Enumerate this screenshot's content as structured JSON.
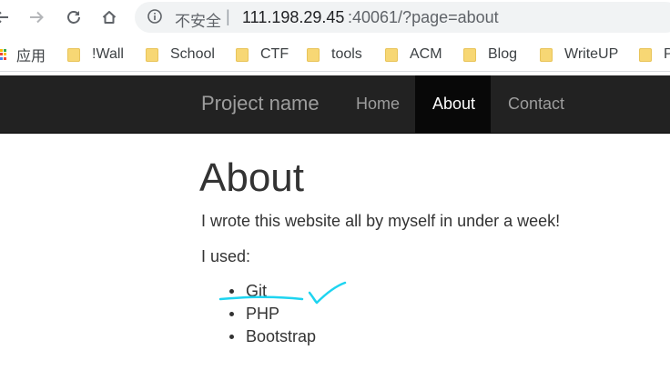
{
  "browser": {
    "security_label": "不安全",
    "separator": "|",
    "url_host": "111.198.29.45",
    "url_rest": ":40061/?page=about"
  },
  "bookmarks": {
    "apps_label": "应用",
    "items": [
      "!Wall",
      "School",
      "CTF",
      "tools",
      "ACM",
      "Blog",
      "WriteUP",
      "P"
    ],
    "folder_color": "#f7d774"
  },
  "navbar": {
    "brand": "Project name",
    "links": [
      "Home",
      "About",
      "Contact"
    ],
    "active": "About",
    "background": "#222222"
  },
  "page": {
    "title": "About",
    "intro": "I wrote this website all by myself in under a week!",
    "used_label": "I used:",
    "tools": [
      "Git",
      "PHP",
      "Bootstrap"
    ]
  },
  "annotation": {
    "color": "#1ed4f0",
    "mark": "checkmark"
  }
}
